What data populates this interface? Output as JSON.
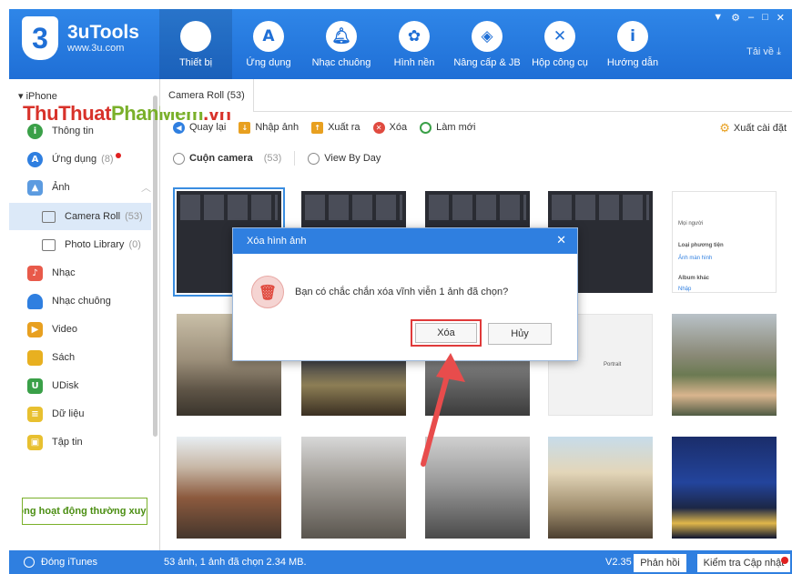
{
  "app": {
    "name": "3uTools",
    "url": "www.3u.com"
  },
  "nav": [
    {
      "label": "Thiết bị",
      "icon": "apple-icon"
    },
    {
      "label": "Ứng dụng",
      "icon": "appstore-icon"
    },
    {
      "label": "Nhạc chuông",
      "icon": "bell-icon"
    },
    {
      "label": "Hình nền",
      "icon": "flower-icon"
    },
    {
      "label": "Nâng cấp & JB",
      "icon": "dropbox-icon"
    },
    {
      "label": "Hộp công cụ",
      "icon": "tools-icon"
    },
    {
      "label": "Hướng dẫn",
      "icon": "info-icon"
    }
  ],
  "window": {
    "download": "Tải về"
  },
  "sidebar": {
    "device": "iPhone",
    "watermark_a": "ThuThuat",
    "watermark_b": "PhanMem",
    "watermark_c": ".vn",
    "items": [
      {
        "label": "Thông tin",
        "color": "#3aa048",
        "glyph": "i"
      },
      {
        "label": "Ứng dụng",
        "count": "(8)",
        "color": "#2f7fe0",
        "glyph": "A"
      },
      {
        "label": "Ảnh",
        "color": "#5c9be0",
        "glyph": "▲"
      },
      {
        "label": "Camera Roll",
        "count": "(53)"
      },
      {
        "label": "Photo Library",
        "count": "(0)"
      },
      {
        "label": "Nhạc",
        "color": "#e85a4a",
        "glyph": "♪"
      },
      {
        "label": "Nhạc chuông",
        "color": "#2f7fe0",
        "glyph": "♫"
      },
      {
        "label": "Video",
        "color": "#e8a020",
        "glyph": "▶"
      },
      {
        "label": "Sách",
        "color": "#e8b020",
        "glyph": "▤"
      },
      {
        "label": "UDisk",
        "color": "#3aa048",
        "glyph": "U"
      },
      {
        "label": "Dữ liệu",
        "color": "#e8c030",
        "glyph": "≡"
      },
      {
        "label": "Tập tin",
        "color": "#e8c030",
        "glyph": "▣"
      }
    ],
    "promo": "ông hoạt động thường xuyê"
  },
  "tab": {
    "label": "Camera Roll (53)"
  },
  "toolbar": {
    "back": "Quay lại",
    "import": "Nhập ảnh",
    "export": "Xuất ra",
    "delete": "Xóa",
    "refresh": "Làm mới",
    "export_settings": "Xuất cài đặt"
  },
  "filter": {
    "camera": "Cuộn camera",
    "count": "(53)",
    "by_day": "View By Day"
  },
  "thumbs": {
    "album_people": "Mọi người",
    "album_media": "Loại phương tiện",
    "album_shot": "Ảnh màn hình",
    "album_other": "Album khác",
    "album_import": "Nhập",
    "portrait": "Portrait"
  },
  "dialog": {
    "title": "Xóa hình ảnh",
    "message": "Bạn có chắc chắn xóa vĩnh viễn 1 ảnh đã chọn?",
    "confirm": "Xóa",
    "cancel": "Hủy"
  },
  "status": {
    "itunes": "Đóng iTunes",
    "info": "53 ảnh, 1 ảnh đã chọn 2.34 MB.",
    "version": "V2.35",
    "feedback": "Phản hồi",
    "update": "Kiểm tra Cập nhật"
  }
}
